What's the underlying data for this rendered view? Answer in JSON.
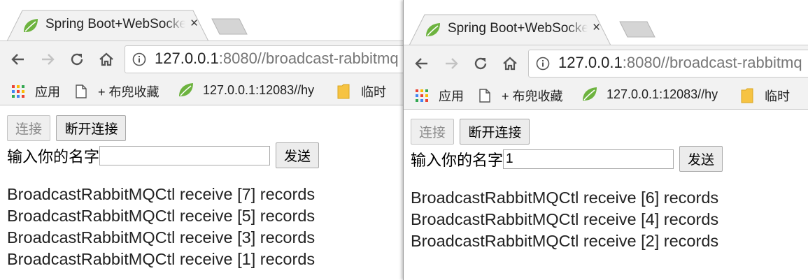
{
  "left": {
    "tab": {
      "title": "Spring Boot+WebSocket",
      "close": "×"
    },
    "url": {
      "host": "127.0.0.1",
      "rest": ":8080//broadcast-rabbitmq"
    },
    "bookmarks": [
      "应用",
      "+ 布兜收藏",
      "127.0.0.1:12083//hy",
      "临时"
    ],
    "buttons": {
      "connect": "连接",
      "disconnect": "断开连接",
      "send": "发送"
    },
    "name_label": "输入你的名字",
    "name_value": "",
    "messages": [
      "BroadcastRabbitMQCtl receive [7] records",
      "BroadcastRabbitMQCtl receive [5] records",
      "BroadcastRabbitMQCtl receive [3] records",
      "BroadcastRabbitMQCtl receive [1] records"
    ]
  },
  "right": {
    "tab": {
      "title": "Spring Boot+WebSocket",
      "close": "×"
    },
    "url": {
      "host": "127.0.0.1",
      "rest": ":8080//broadcast-rabbitmq"
    },
    "bookmarks": [
      "应用",
      "+ 布兜收藏",
      "127.0.0.1:12083//hy",
      "临时"
    ],
    "buttons": {
      "connect": "连接",
      "disconnect": "断开连接",
      "send": "发送"
    },
    "name_label": "输入你的名字",
    "name_value": "1",
    "messages": [
      "BroadcastRabbitMQCtl receive [6] records",
      "BroadcastRabbitMQCtl receive [4] records",
      "BroadcastRabbitMQCtl receive [2] records"
    ]
  },
  "colors": {
    "toolbar": "#f2f2f2",
    "spring_green": "#6db33f",
    "text": "#222222"
  },
  "icons": [
    "spring-leaf-icon",
    "back-icon",
    "forward-icon",
    "reload-icon",
    "home-icon",
    "info-icon",
    "apps-grid-icon",
    "page-icon",
    "folder-icon"
  ]
}
